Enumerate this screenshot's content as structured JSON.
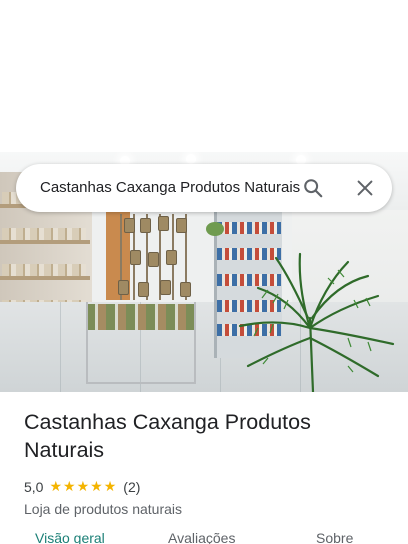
{
  "search": {
    "query": "Castanhas Caxanga Produtos Naturais",
    "search_icon": "search-icon",
    "clear_icon": "close-icon"
  },
  "photo": {
    "description_icon": "store-photo"
  },
  "place": {
    "title": "Castanhas Caxanga Produtos Naturais",
    "rating": "5,0",
    "stars": 5,
    "review_count": "(2)",
    "category": "Loja de produtos naturais"
  },
  "tabs": [
    {
      "label": "Visão geral",
      "active": true
    },
    {
      "label": "Avaliações",
      "active": false
    },
    {
      "label": "Sobre",
      "active": false
    }
  ],
  "colors": {
    "star": "#f4b400",
    "active_tab": "#1a7f76",
    "title_text": "#202124"
  }
}
